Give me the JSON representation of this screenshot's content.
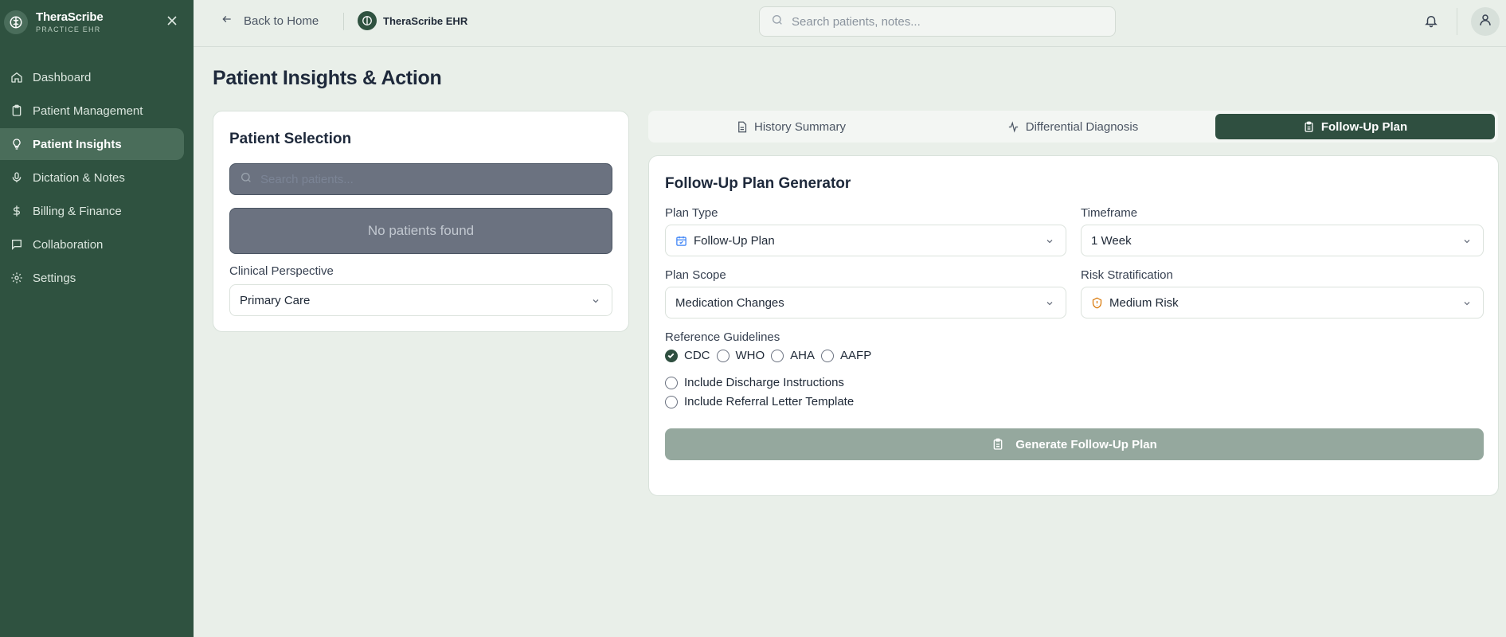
{
  "sidebar": {
    "brand_name": "TheraScribe",
    "brand_sub": "PRACTICE EHR",
    "items": [
      {
        "label": "Dashboard",
        "icon": "home-icon"
      },
      {
        "label": "Patient Management",
        "icon": "clipboard-icon"
      },
      {
        "label": "Patient Insights",
        "icon": "lightbulb-icon",
        "active": true
      },
      {
        "label": "Dictation & Notes",
        "icon": "microphone-icon"
      },
      {
        "label": "Billing & Finance",
        "icon": "dollar-icon"
      },
      {
        "label": "Collaboration",
        "icon": "message-icon"
      },
      {
        "label": "Settings",
        "icon": "gear-icon"
      }
    ]
  },
  "topbar": {
    "back_label": "Back to Home",
    "app_name": "TheraScribe EHR",
    "search_placeholder": "Search patients, notes..."
  },
  "page": {
    "title": "Patient Insights & Action"
  },
  "patient_selection": {
    "title": "Patient Selection",
    "search_placeholder": "Search patients...",
    "empty_text": "No patients found",
    "perspective_label": "Clinical Perspective",
    "perspective_value": "Primary Care"
  },
  "tabs": [
    {
      "label": "History Summary",
      "icon": "document-icon"
    },
    {
      "label": "Differential Diagnosis",
      "icon": "activity-icon"
    },
    {
      "label": "Follow-Up Plan",
      "icon": "clipboard-icon",
      "active": true
    }
  ],
  "generator": {
    "title": "Follow-Up Plan Generator",
    "plan_type_label": "Plan Type",
    "plan_type_value": "Follow-Up Plan",
    "timeframe_label": "Timeframe",
    "timeframe_value": "1 Week",
    "plan_scope_label": "Plan Scope",
    "plan_scope_value": "Medication Changes",
    "risk_label": "Risk Stratification",
    "risk_value": "Medium Risk",
    "guidelines_label": "Reference Guidelines",
    "guidelines": [
      {
        "label": "CDC",
        "checked": true
      },
      {
        "label": "WHO",
        "checked": false
      },
      {
        "label": "AHA",
        "checked": false
      },
      {
        "label": "AAFP",
        "checked": false
      }
    ],
    "options": [
      {
        "label": "Include Discharge Instructions",
        "checked": false
      },
      {
        "label": "Include Referral Letter Template",
        "checked": false
      }
    ],
    "button_label": "Generate Follow-Up Plan"
  },
  "colors": {
    "sidebar": "#2f5240",
    "accent": "#2f4f40",
    "background": "#e9efe9",
    "button_disabled": "#95a89e"
  }
}
